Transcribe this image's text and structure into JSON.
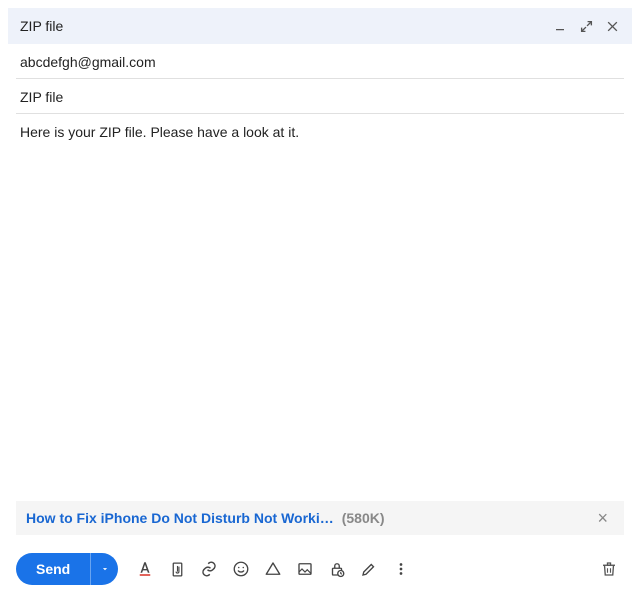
{
  "colors": {
    "accent": "#1a73e8",
    "headerBg": "#eef2fa",
    "link": "#1967d2"
  },
  "header": {
    "title": "ZIP file"
  },
  "compose": {
    "to": "abcdefgh@gmail.com",
    "subject": "ZIP file",
    "body": "Here is your ZIP file. Please have a look at it."
  },
  "attachment": {
    "name": "How to Fix iPhone Do Not Disturb Not Worki…",
    "size": "(580K)"
  },
  "toolbar": {
    "send_label": "Send"
  },
  "icons": {
    "minimize": "minimize-icon",
    "expand": "expand-icon",
    "close": "close-icon",
    "format": "text-format-icon",
    "attach": "attach-file-icon",
    "link": "insert-link-icon",
    "emoji": "insert-emoji-icon",
    "drive": "insert-drive-icon",
    "photo": "insert-photo-icon",
    "confidential": "confidential-mode-icon",
    "signature": "insert-signature-icon",
    "more": "more-options-icon",
    "trash": "delete-draft-icon",
    "removeAttachment": "remove-attachment-icon",
    "sendMore": "send-options-dropdown-icon"
  }
}
